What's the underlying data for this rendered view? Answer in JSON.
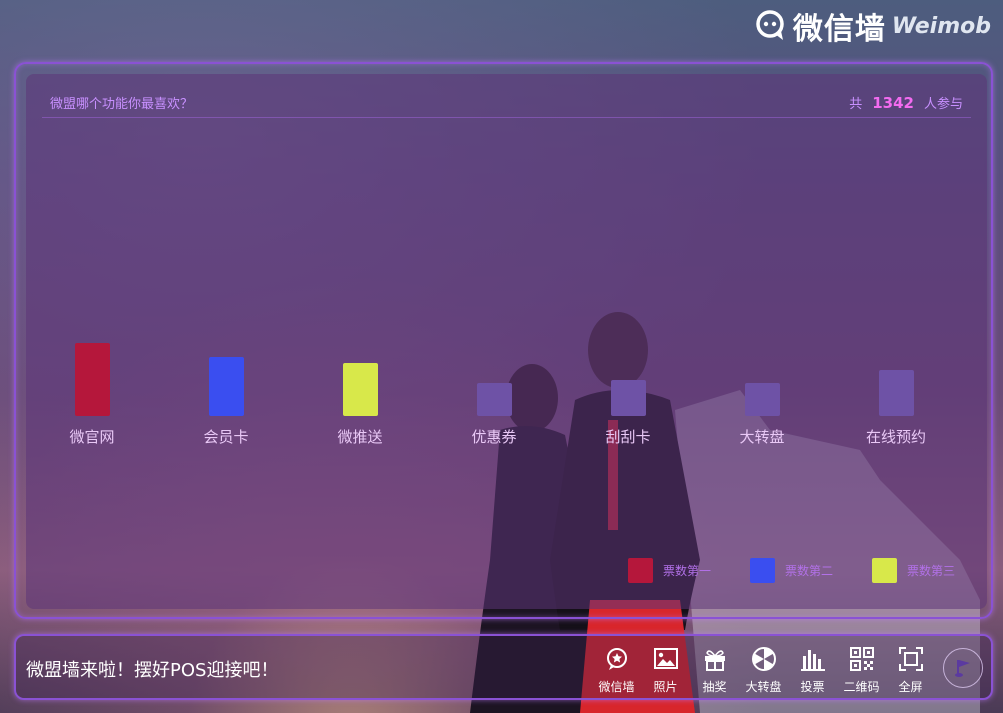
{
  "brand": {
    "name": "微信墙",
    "sub": "Weimob"
  },
  "vote": {
    "question": "微盟哪个功能你最喜欢？",
    "count_prefix": "共",
    "count": "1342",
    "count_suffix": "人参与",
    "bar_color_default": "#6e52a6",
    "options": [
      {
        "label": "微官网",
        "level": 0.22,
        "color": "#b5173b"
      },
      {
        "label": "会员卡",
        "level": 0.18,
        "color": "#3a4ef0"
      },
      {
        "label": "微推送",
        "level": 0.16,
        "color": "#d8e84a"
      },
      {
        "label": "优惠券",
        "level": 0.1,
        "color": "#6e52a6"
      },
      {
        "label": "刮刮卡",
        "level": 0.11,
        "color": "#6e52a6"
      },
      {
        "label": "大转盘",
        "level": 0.1,
        "color": "#6e52a6"
      },
      {
        "label": "在线预约",
        "level": 0.14,
        "color": "#6e52a6"
      }
    ],
    "legend": [
      {
        "label": "票数第一",
        "color": "#b5173b"
      },
      {
        "label": "票数第二",
        "color": "#3a4ef0"
      },
      {
        "label": "票数第三",
        "color": "#d8e84a"
      }
    ]
  },
  "ticker": {
    "text": "微盟墙来啦！摆好POS迎接吧！"
  },
  "nav": [
    {
      "label": "微信墙",
      "icon": "wechat-wall-icon"
    },
    {
      "label": "照片",
      "icon": "photo-icon"
    },
    {
      "label": "抽奖",
      "icon": "gift-icon"
    },
    {
      "label": "大转盘",
      "icon": "wheel-icon"
    },
    {
      "label": "投票",
      "icon": "vote-chart-icon"
    },
    {
      "label": "二维码",
      "icon": "qrcode-icon"
    },
    {
      "label": "全屏",
      "icon": "fullscreen-icon"
    }
  ],
  "music": {
    "icon": "music-flag-icon"
  }
}
